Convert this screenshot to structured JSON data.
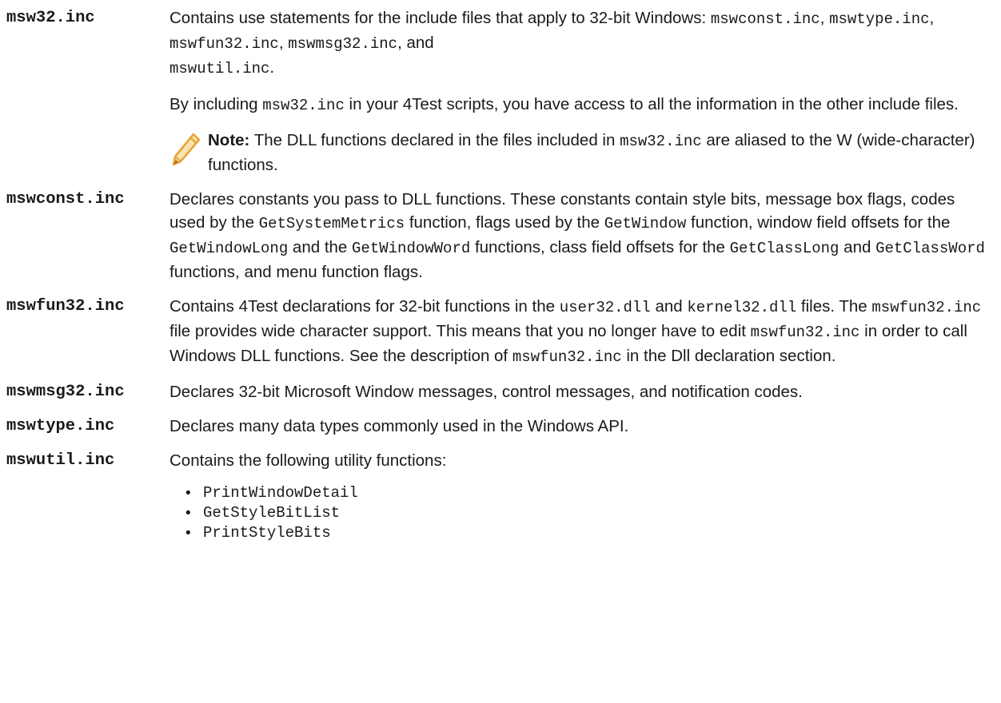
{
  "entries": {
    "msw32": {
      "term": "msw32.inc",
      "p1": [
        "Contains use statements for the include files that apply to 32-bit Windows: ",
        "mswconst.inc",
        ", ",
        "mswtype.inc",
        ", ",
        "mswfun32.inc",
        ", ",
        "mswmsg32.inc",
        ", and ",
        "mswutil.inc",
        "."
      ],
      "p2": [
        "By including ",
        "msw32.inc",
        " in your 4Test scripts, you have access to all the information in the other include files."
      ],
      "note": {
        "label": "Note:",
        "text": [
          " The DLL functions declared in the files included in ",
          "msw32.inc",
          " are aliased to the W (wide-character) functions."
        ]
      }
    },
    "mswconst": {
      "term": "mswconst.inc",
      "p1": [
        "Declares constants you pass to DLL functions. These constants contain style bits, message box flags, codes used by the ",
        "GetSystemMetrics",
        " function, flags used by the ",
        "GetWindow",
        " function, window field offsets for the ",
        "GetWindowLong",
        " and the ",
        "GetWindowWord",
        " functions, class field offsets for the ",
        "GetClassLong",
        " and ",
        "GetClassWord",
        " functions, and menu function flags."
      ]
    },
    "mswfun32": {
      "term": "mswfun32.inc",
      "p1": [
        "Contains 4Test declarations for 32-bit functions in the ",
        "user32.dll",
        " and ",
        "kernel32.dll",
        " files. The ",
        "mswfun32.inc",
        " file provides wide character support. This means that you no longer have to edit ",
        "mswfun32.inc",
        " in order to call Windows DLL functions. See the description of ",
        "mswfun32.inc",
        " in the Dll declaration section."
      ]
    },
    "mswmsg32": {
      "term": "mswmsg32.inc",
      "p1": [
        "Declares 32-bit Microsoft Window messages, control messages, and notification codes."
      ]
    },
    "mswtype": {
      "term": "mswtype.inc",
      "p1": [
        "Declares many data types commonly used in the Windows API."
      ]
    },
    "mswutil": {
      "term": "mswutil.inc",
      "p1": [
        "Contains the following utility functions:"
      ],
      "functions": [
        "PrintWindowDetail",
        "GetStyleBitList",
        "PrintStyleBits"
      ]
    }
  },
  "colors": {
    "text": "#1a1a1a",
    "note_icon": "#e8a53a"
  },
  "icons": {
    "note": "pencil-icon"
  }
}
